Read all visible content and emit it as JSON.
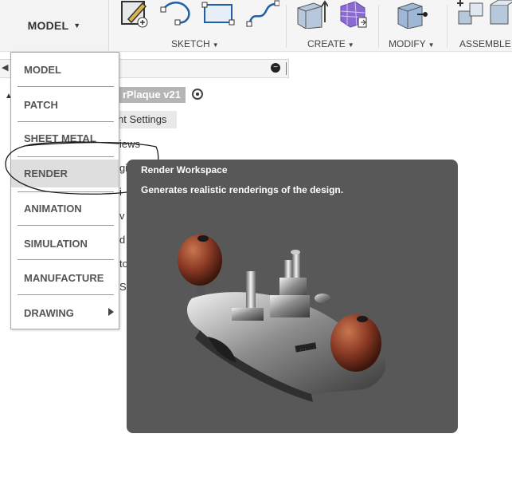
{
  "toolbar": {
    "workspace_button": "MODEL",
    "groups": [
      {
        "label": "SKETCH"
      },
      {
        "label": "CREATE"
      },
      {
        "label": "MODIFY"
      },
      {
        "label": "ASSEMBLE"
      }
    ]
  },
  "browser": {
    "document_title": "rPlaque v21",
    "partial_rows": [
      "nt Settings",
      "iews",
      "gi",
      "i",
      "v",
      "d",
      "to",
      "S"
    ]
  },
  "workspace_menu": {
    "items": [
      {
        "label": "MODEL"
      },
      {
        "label": "PATCH"
      },
      {
        "label": "SHEET METAL"
      },
      {
        "label": "RENDER"
      },
      {
        "label": "ANIMATION"
      },
      {
        "label": "SIMULATION"
      },
      {
        "label": "MANUFACTURE"
      },
      {
        "label": "DRAWING"
      }
    ],
    "highlighted": "RENDER"
  },
  "tooltip": {
    "title": "Render Workspace",
    "description": "Generates realistic renderings of the design."
  },
  "colors": {
    "tooltip_bg": "#585858",
    "menu_highlight": "#dedede",
    "knob": "#8b3a25"
  },
  "icons": [
    "sketch-line-icon",
    "arc-icon",
    "rectangle-icon",
    "spline-icon",
    "extrude-icon",
    "form-icon",
    "press-pull-icon",
    "new-component-icon"
  ]
}
